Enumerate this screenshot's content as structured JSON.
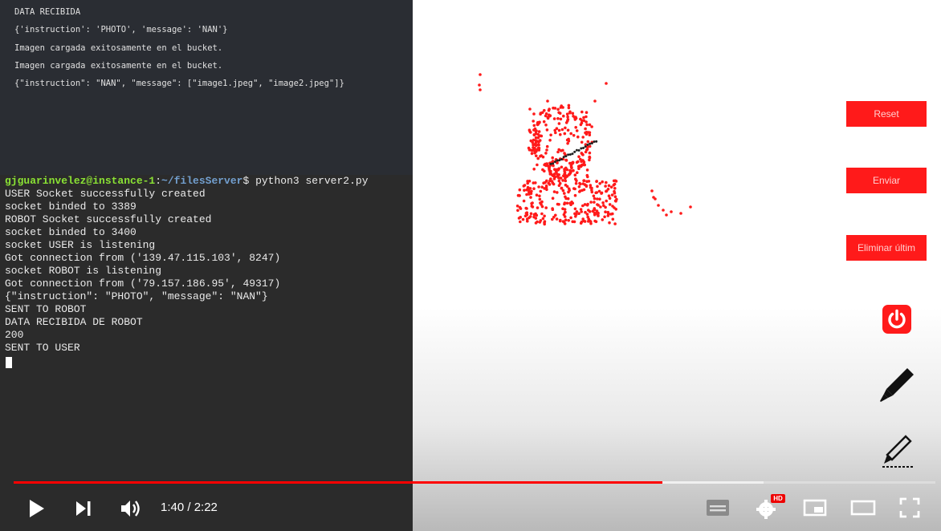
{
  "top_console": {
    "lines": [
      "DATA RECIBIDA",
      "{'instruction': 'PHOTO', 'message': 'NAN'}",
      "Imagen cargada exitosamente en el bucket.",
      "Imagen cargada exitosamente en el bucket.",
      "{\"instruction\": \"NAN\", \"message\": [\"image1.jpeg\", \"image2.jpeg\"]}"
    ]
  },
  "terminal": {
    "prompt_user": "gjguarinvelez@instance-1",
    "prompt_sep": ":",
    "prompt_path": "~/filesServer",
    "prompt_cmd": "$ python3 server2.py",
    "lines": [
      "USER Socket successfully created",
      "socket binded to 3389",
      "ROBOT Socket successfully created",
      "socket binded to 3400",
      "socket USER is listening",
      "Got connection from ('139.47.115.103', 8247)",
      "socket ROBOT is listening",
      "Got connection from ('79.157.186.95', 49317)",
      "{\"instruction\": \"PHOTO\", \"message\": \"NAN\"}",
      "SENT TO ROBOT",
      "DATA RECIBIDA DE ROBOT",
      "200",
      "SENT TO USER"
    ]
  },
  "app": {
    "reset_label": "Reset",
    "send_label": "Enviar",
    "delete_last_label": "Eliminar últim",
    "accent_color": "#ff1a1a",
    "icons": [
      "power-icon",
      "pen-icon",
      "pen-line-icon"
    ]
  },
  "player": {
    "time_current": "1:40",
    "time_total": "2:22",
    "time_display": "1:40 / 2:22",
    "progress_played": 0.704,
    "progress_buffered": 0.814,
    "hd_badge": "HD",
    "icons": [
      "play-icon",
      "next-icon",
      "volume-icon",
      "subtitles-icon",
      "settings-icon",
      "miniplayer-icon",
      "theater-icon",
      "fullscreen-icon"
    ]
  }
}
